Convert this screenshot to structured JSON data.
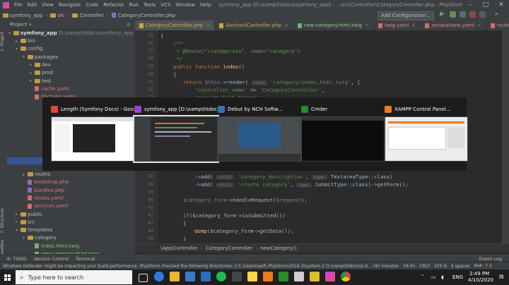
{
  "window": {
    "title": "symfony_app [D:\\xamp\\htdocs\\symfony_app] - ...\\src\\Controller\\CategoryController.php - PhpStorm"
  },
  "menu": [
    "File",
    "Edit",
    "View",
    "Navigate",
    "Code",
    "Refactor",
    "Run",
    "Tools",
    "VCS",
    "Window",
    "Help"
  ],
  "navbar": {
    "crumbs": [
      "symfony_app",
      "src",
      "Controller",
      "CategoryController.php"
    ],
    "add_configuration": "Add Configuration..."
  },
  "project_panel": {
    "header": "Project",
    "root": "symfony_app",
    "root_path": "D:\\xamp\\htdocs\\symfony_app",
    "items_top": [
      {
        "label": "bin",
        "indent": 1,
        "type": "folder",
        "open": false
      },
      {
        "label": "config",
        "indent": 1,
        "type": "folder",
        "open": true
      },
      {
        "label": "packages",
        "indent": 2,
        "type": "folder",
        "open": true
      },
      {
        "label": "dev",
        "indent": 3,
        "type": "folder",
        "open": false
      },
      {
        "label": "prod",
        "indent": 3,
        "type": "folder",
        "open": false
      },
      {
        "label": "test",
        "indent": 3,
        "type": "folder",
        "open": false
      },
      {
        "label": "cache.yaml",
        "indent": 3,
        "type": "yaml"
      },
      {
        "label": "doctrine.yaml",
        "indent": 3,
        "type": "yaml"
      }
    ],
    "items_bottom": [
      {
        "label": "routes",
        "indent": 2,
        "type": "folder",
        "open": false
      },
      {
        "label": "bootstrap.php",
        "indent": 2,
        "type": "php"
      },
      {
        "label": "bundles.php",
        "indent": 2,
        "type": "php"
      },
      {
        "label": "routes.yaml",
        "indent": 2,
        "type": "yaml"
      },
      {
        "label": "services.yaml",
        "indent": 2,
        "type": "yaml"
      },
      {
        "label": "public",
        "indent": 1,
        "type": "folder",
        "open": false
      },
      {
        "label": "src",
        "indent": 1,
        "type": "folder",
        "open": false
      },
      {
        "label": "templates",
        "indent": 1,
        "type": "folder",
        "open": true
      },
      {
        "label": "category",
        "indent": 2,
        "type": "folder",
        "open": true
      },
      {
        "label": "index.html.twig",
        "indent": 3,
        "type": "twig"
      },
      {
        "label": "new-category.html.twig",
        "indent": 3,
        "type": "twig"
      }
    ]
  },
  "side_labels": {
    "project": "1: Project",
    "structure": "7: Structure",
    "favorites": "2: Favorites"
  },
  "tabs": [
    {
      "label": "CategoryController.php",
      "active": true,
      "color": "#d1a33c"
    },
    {
      "label": "AbstractController.php",
      "active": false,
      "color": "#d1a33c"
    },
    {
      "label": "new-category.html.twig",
      "active": false,
      "color": "#6fb36b"
    },
    {
      "label": "twig.yaml",
      "active": false,
      "color": "#d16c6c"
    },
    {
      "label": "annotations.yaml",
      "active": false,
      "color": "#d16c6c"
    },
    {
      "label": "routes.yaml",
      "active": false,
      "color": "#d16c6c"
    },
    {
      "label": "index",
      "active": false,
      "color": "#6fb36b"
    }
  ],
  "line_numbers_top": [
    "15",
    "16",
    "17",
    "18",
    "19",
    "20",
    "21",
    "22",
    "23",
    "24",
    "25",
    "26"
  ],
  "line_numbers_bottom": [
    "37",
    "38",
    "39",
    "40",
    "41",
    "42",
    "43",
    "44",
    "45",
    "46",
    "47",
    "48",
    "49"
  ],
  "code_top": {
    "l15": "{",
    "l16": "/**",
    "l17": " * @Route(\"/categories\", name=\"category\")",
    "l18": " */",
    "l19_kw": "public function",
    "l19_fn": "index",
    "l19_rest": "()",
    "l20": "{",
    "l21_kw": "return",
    "l21_var": "$this",
    "l21_call": "->render(",
    "l21_hint": "view:",
    "l21_str": "'category/index.html.twig'",
    "l21_end": ", [",
    "l22_str1": "'controller_name'",
    "l22_op": " => ",
    "l22_str2": "'CategoryController'",
    "l22_end": ",",
    "l23_str1": "'name'",
    "l23_op": "=>",
    "l23_str2": "'Asif Rahman'",
    "l24": "]);",
    "l25": "}"
  },
  "code_bottom": {
    "l37_call": "->add(",
    "l37_hint": "child:",
    "l37_str": "'category_description'",
    "l37_hint2": "type:",
    "l37_type": "TextareaType::class",
    "l37_end": ")",
    "l38_call": "->add(",
    "l38_hint": "child:",
    "l38_str": "'create_category'",
    "l38_hint2": "type:",
    "l38_type": "SubmitType::class",
    "l38_end": ")->getForm();",
    "l40_var": "$category_form",
    "l40_rest": "->handleRequest(",
    "l40_arg": "$request",
    "l40_end": ");",
    "l42_kw": "if",
    "l42_rest": "($category_form->isSubmitted())",
    "l43": "{",
    "l44_fn": "dump",
    "l44_rest": "($category_form->getData());",
    "l45": "}",
    "l47_kw": "return",
    "l47_var": "$this",
    "l47_call": "->render(",
    "l47_hint": "view:",
    "l47_str": "'category/new-category.html.twig'",
    "l47_end": ",[",
    "l48_str": "'category_form'",
    "l48_rest": " => $category_form->createView()"
  },
  "editor_breadcrumb": [
    "\\App\\Controller",
    "CategoryController",
    "newCategory()"
  ],
  "tool_windows": [
    "6: TODO",
    "Version Control",
    "Terminal"
  ],
  "event_log": "Event Log",
  "status": {
    "message": "Windows Defender might be impacting your build performance. PhpStorm checked the following directories: // C:\\Users\\asif\\.PhpStorm2019.3\\system // D:\\xamp\\htdocs\\s-d... (42 minutes ago)",
    "position": "34:45",
    "line_ending": "CRLF",
    "encoding": "UTF-8",
    "indent": "4 spaces",
    "php": "PHP: 7.3"
  },
  "alt_tab": {
    "windows": [
      {
        "title": "Length (Symfony Docs) - Goo...",
        "icon_color": "#e8453c",
        "selected": false
      },
      {
        "title": "symfony_app [D:\\xamp\\htdoc...",
        "icon_color": "#a03fd8",
        "selected": true
      },
      {
        "title": "Debut by NCH Softw...",
        "icon_color": "#3b6fb6",
        "selected": false
      },
      {
        "title": "Cmder",
        "icon_color": "#2c8a2c",
        "selected": false
      },
      {
        "title": "XAMPP Control Panel...",
        "icon_color": "#f07a1c",
        "selected": false
      }
    ]
  },
  "taskbar": {
    "search_placeholder": "Type here to search",
    "time": "2:49 PM",
    "date": "4/10/2020",
    "lang": "ENG"
  }
}
